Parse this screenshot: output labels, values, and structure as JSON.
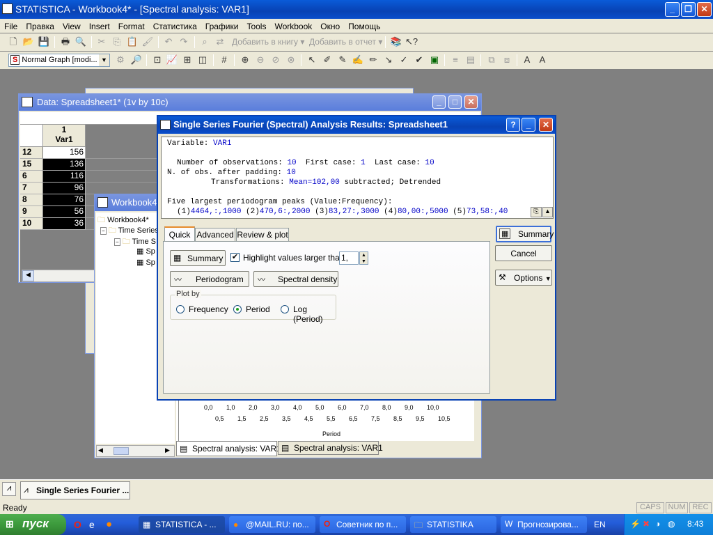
{
  "app": {
    "title": "STATISTICA - Workbook4* - [Spectral analysis: VAR1]",
    "icon": "statistica-logo-icon"
  },
  "menu": [
    "File",
    "Правка",
    "View",
    "Insert",
    "Format",
    "Статистика",
    "Графики",
    "Tools",
    "Workbook",
    "Окно",
    "Помощь"
  ],
  "toolbar": {
    "add_to_book": "Добавить в книгу",
    "add_to_report": "Добавить в отчет",
    "graph_style": "Normal Graph [modi..."
  },
  "data_window": {
    "title": "Data: Spreadsheet1* (1v by 10c)",
    "col_number": "1",
    "col_name": "Var1",
    "rows": [
      {
        "case": "12",
        "value": "156"
      },
      {
        "case": "15",
        "value": "136"
      },
      {
        "case": "6",
        "value": "116"
      },
      {
        "case": "7",
        "value": "96"
      },
      {
        "case": "8",
        "value": "76"
      },
      {
        "case": "9",
        "value": "56"
      },
      {
        "case": "10",
        "value": "36"
      }
    ]
  },
  "workbook_window": {
    "title": "Workbook4*",
    "tree": {
      "root": "Workbook4*",
      "level1": "Time Series",
      "level2": "Time S",
      "leaf1": "Sp",
      "leaf2": "Sp"
    },
    "tabs": [
      "Spectral analysis: VAR1",
      "Spectral analysis: VAR1"
    ],
    "x_ticks_top": [
      "0,0",
      "1,0",
      "2,0",
      "3,0",
      "4,0",
      "5,0",
      "6,0",
      "7,0",
      "8,0",
      "9,0",
      "10,0"
    ],
    "x_ticks_bottom": [
      "0,5",
      "1,5",
      "2,5",
      "3,5",
      "4,5",
      "5,5",
      "6,5",
      "7,5",
      "8,5",
      "9,5",
      "10,5"
    ],
    "x_axis_label": "Period",
    "y_tick_zero": "0"
  },
  "dialog": {
    "title": "Single Series Fourier (Spectral) Analysis Results: Spreadsheet1",
    "output": {
      "variable_label": "Variable:",
      "variable_value": "VAR1",
      "nobs_label": "Number of observations:",
      "nobs_value": "10",
      "first_label": "First case:",
      "first_value": "1",
      "last_label": "Last case:",
      "last_value": "10",
      "padding_label": "N. of obs. after padding:",
      "padding_value": "10",
      "transform_label": "Transformations:",
      "transform_value": "Mean=102,00",
      "transform_rest": "subtracted; Detrended",
      "peaks_header": "Five largest periodogram peaks (Value:Frequency):",
      "peaks": [
        {
          "n": "(1)",
          "v": "4464,:,1000"
        },
        {
          "n": "(2)",
          "v": "470,6:,2000"
        },
        {
          "n": "(3)",
          "v": "83,27:,3000"
        },
        {
          "n": "(4)",
          "v": "80,00:,5000"
        },
        {
          "n": "(5)",
          "v": "73,58:,40"
        }
      ]
    },
    "tabs": [
      "Quick",
      "Advanced",
      "Review & plot"
    ],
    "summary_button": "Summary",
    "highlight_label": "Highlight values larger than:",
    "highlight_value": "1,",
    "highlight_checked": true,
    "periodogram_button": "Periodogram",
    "spectral_density_button": "Spectral density",
    "plot_by_label": "Plot by",
    "plot_by_options": [
      "Frequency",
      "Period",
      "Log (Period)"
    ],
    "plot_by_selected": "Period",
    "side_summary": "Summary",
    "cancel": "Cancel",
    "options": "Options"
  },
  "mdi_taskbar": {
    "item": "Single Series Fourier ..."
  },
  "status": {
    "text": "Ready",
    "caps": "CAPS",
    "num": "NUM",
    "rec": "REC"
  },
  "taskbar": {
    "start": "пуск",
    "items": [
      "STATISTICA - ...",
      "@MAIL.RU: по...",
      "Советник по п...",
      "STATISTIKA",
      "Прогнозирова..."
    ],
    "lang": "EN",
    "clock": "8:43"
  },
  "colors": {
    "xp_blue": "#0a5bd8",
    "dialog_face": "#ece9d8",
    "output_blue": "#0000c8",
    "start_green": "#3c9a3c"
  }
}
